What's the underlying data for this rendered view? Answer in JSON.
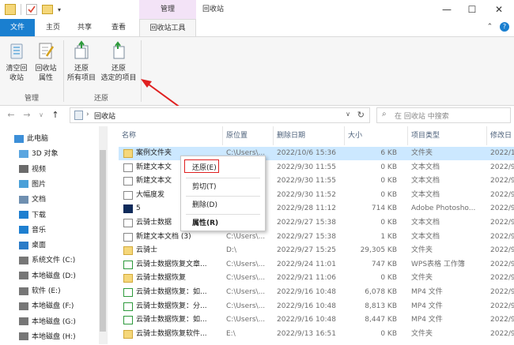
{
  "titlebar": {
    "context_tab": "管理",
    "window_title": "回收站",
    "min": "—",
    "max": "☐",
    "close": "✕"
  },
  "tabs": {
    "file": "文件",
    "home": "主页",
    "share": "共享",
    "view": "查看",
    "tools": "回收站工具"
  },
  "ribbon": {
    "empty_bin": [
      "清空回",
      "收站"
    ],
    "bin_props": [
      "回收站",
      "属性"
    ],
    "restore_all": [
      "还原",
      "所有项目"
    ],
    "restore_selected": [
      "还原",
      "选定的项目"
    ],
    "group_manage": "管理",
    "group_restore": "还原"
  },
  "address": {
    "path": "回收站",
    "search_placeholder": "在 回收站 中搜索"
  },
  "nav": [
    {
      "label": "此电脑",
      "indent": 0,
      "color": "#3c8fd8"
    },
    {
      "label": "3D 对象",
      "indent": 1,
      "color": "#5aa6e0"
    },
    {
      "label": "视频",
      "indent": 1,
      "color": "#6b6b6b"
    },
    {
      "label": "图片",
      "indent": 1,
      "color": "#4aa0d8"
    },
    {
      "label": "文档",
      "indent": 1,
      "color": "#6f8fb0"
    },
    {
      "label": "下载",
      "indent": 1,
      "color": "#1e7fd0"
    },
    {
      "label": "音乐",
      "indent": 1,
      "color": "#1e7fd0"
    },
    {
      "label": "桌面",
      "indent": 1,
      "color": "#2b7cc8"
    },
    {
      "label": "系统文件 (C:)",
      "indent": 1,
      "color": "#777"
    },
    {
      "label": "本地磁盘 (D:)",
      "indent": 1,
      "color": "#777"
    },
    {
      "label": "软件 (E:)",
      "indent": 1,
      "color": "#777"
    },
    {
      "label": "本地磁盘 (F:)",
      "indent": 1,
      "color": "#777"
    },
    {
      "label": "本地磁盘 (G:)",
      "indent": 1,
      "color": "#777"
    },
    {
      "label": "本地磁盘 (H:)",
      "indent": 1,
      "color": "#777"
    }
  ],
  "columns": [
    "名称",
    "原位置",
    "删除日期",
    "大小",
    "项目类型",
    "修改日"
  ],
  "files": [
    {
      "name": "案例文件夹",
      "loc": "C:\\Users\\...",
      "date": "2022/10/6 15:36",
      "size": "6 KB",
      "type": "文件夹",
      "mod": "2022/1",
      "icon": "folder",
      "selected": true
    },
    {
      "name": "新建文本文",
      "loc": "",
      "date": "2022/9/30 11:55",
      "size": "0 KB",
      "type": "文本文档",
      "mod": "2022/9",
      "icon": "doc"
    },
    {
      "name": "新建文本文",
      "loc": "",
      "date": "2022/9/30 11:55",
      "size": "0 KB",
      "type": "文本文档",
      "mod": "2022/9",
      "icon": "doc"
    },
    {
      "name": "大幅度发",
      "loc": "",
      "date": "2022/9/30 11:52",
      "size": "0 KB",
      "type": "文本文档",
      "mod": "2022/9",
      "icon": "doc"
    },
    {
      "name": "5",
      "loc": "",
      "date": "2022/9/28 11:12",
      "size": "714 KB",
      "type": "Adobe Photosho...",
      "mod": "2022/9",
      "icon": "ps"
    },
    {
      "name": "云骑士数据",
      "loc": "",
      "date": "2022/9/27 15:38",
      "size": "0 KB",
      "type": "文本文档",
      "mod": "2022/9",
      "icon": "doc"
    },
    {
      "name": "新建文本文档 (3)",
      "loc": "C:\\Users\\...",
      "date": "2022/9/27 15:38",
      "size": "1 KB",
      "type": "文本文档",
      "mod": "2022/9",
      "icon": "doc"
    },
    {
      "name": "云骑士",
      "loc": "D:\\",
      "date": "2022/9/27 15:25",
      "size": "29,305 KB",
      "type": "文件夹",
      "mod": "2022/9",
      "icon": "folder"
    },
    {
      "name": "云骑士数据恢复文章...",
      "loc": "C:\\Users\\...",
      "date": "2022/9/24 11:01",
      "size": "747 KB",
      "type": "WPS表格 工作簿",
      "mod": "2022/9",
      "icon": "xls"
    },
    {
      "name": "云骑士数据恢复",
      "loc": "C:\\Users\\...",
      "date": "2022/9/21 11:06",
      "size": "0 KB",
      "type": "文件夹",
      "mod": "2022/9",
      "icon": "folder"
    },
    {
      "name": "云骑士数据恢复：如...",
      "loc": "C:\\Users\\...",
      "date": "2022/9/16 10:48",
      "size": "6,078 KB",
      "type": "MP4 文件",
      "mod": "2022/9",
      "icon": "mp4"
    },
    {
      "name": "云骑士数据恢复：分...",
      "loc": "C:\\Users\\...",
      "date": "2022/9/16 10:48",
      "size": "8,813 KB",
      "type": "MP4 文件",
      "mod": "2022/9",
      "icon": "mp4"
    },
    {
      "name": "云骑士数据恢复：如...",
      "loc": "C:\\Users\\...",
      "date": "2022/9/16 10:48",
      "size": "8,447 KB",
      "type": "MP4 文件",
      "mod": "2022/9",
      "icon": "mp4"
    },
    {
      "name": "云骑士数据恢复软件...",
      "loc": "E:\\",
      "date": "2022/9/13 16:51",
      "size": "0 KB",
      "type": "文件夹",
      "mod": "2022/9",
      "icon": "folder"
    }
  ],
  "context_menu": {
    "restore": "还原(E)",
    "cut": "剪切(T)",
    "delete": "删除(D)",
    "properties": "属性(R)"
  },
  "colors": {
    "accent": "#1a7fd0",
    "selection": "#cce8ff",
    "annotation": "#e02020",
    "context_tab": "#f3e3f7"
  }
}
